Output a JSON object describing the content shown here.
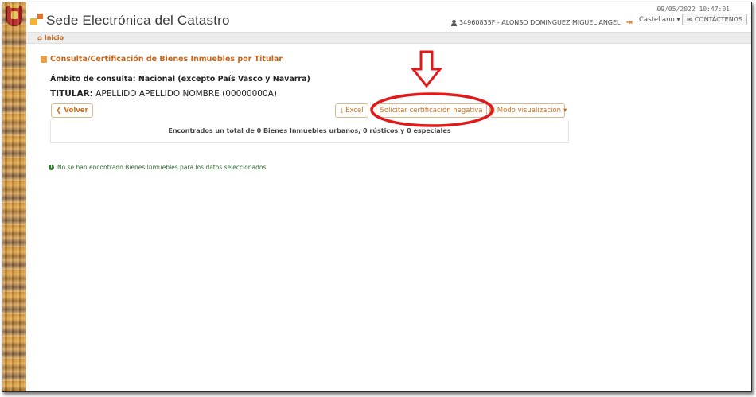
{
  "header": {
    "app_title": "Sede Electrónica del Catastro",
    "user": "34960835F - ALONSO DOMINGUEZ MIGUEL ANGEL",
    "timestamp": "09/05/2022 10:47:01",
    "language": "Castellano ▾",
    "contact_label": "CONTÁCTENOS"
  },
  "nav": {
    "home_label": "Inicio"
  },
  "page": {
    "section_title": "Consulta/Certificación de Bienes Inmuebles por Titular",
    "scope_line": "Ámbito de consulta: Nacional (excepto País Vasco y Navarra)",
    "holder_label": "TITULAR:",
    "holder_value": "APELLIDO APELLIDO NOMBRE (00000000A)"
  },
  "toolbar": {
    "back_label": "Volver",
    "excel_label": "Excel",
    "certify_label": "Solicitar certificación negativa",
    "view_mode_label": "Modo visualización"
  },
  "results": {
    "summary": "Encontrados un total de 0 Bienes Inmuebles urbanos, 0 rústicos y 0 especiales"
  },
  "message": {
    "info": "No se han encontrado Bienes Inmuebles para los datos seleccionados."
  },
  "colors": {
    "accent": "#d0701d",
    "annotation": "#e01a1a",
    "success": "#2f7a2f"
  }
}
